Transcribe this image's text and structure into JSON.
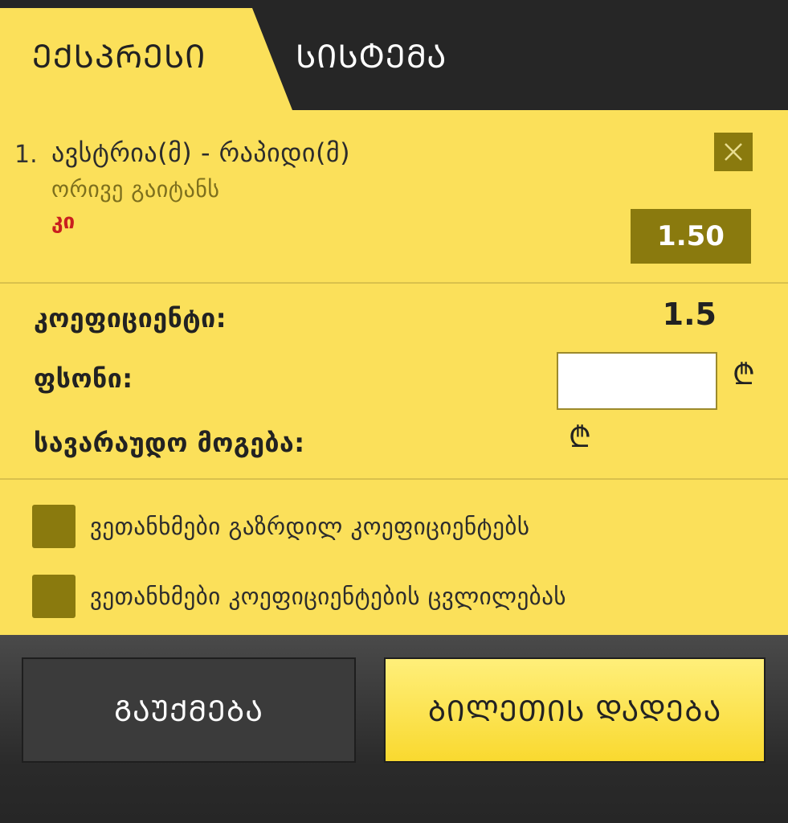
{
  "tabs": [
    {
      "label": "ᲔᲥᲡᲞᲠᲔᲡᲘ",
      "active": true
    },
    {
      "label": "ᲡᲘᲡᲢᲔᲛᲐ",
      "active": false
    }
  ],
  "bet": {
    "index": "1.",
    "match": "ავსტრია(მ) - რაპიდი(მ)",
    "market": "ორივე გაიტანს",
    "selection": "კი",
    "odd": "1.50"
  },
  "summary": {
    "coef_label": "კოეფიციენტი:",
    "coef_value": "1.5",
    "stake_label": "ფსონი:",
    "stake_value": "",
    "win_label": "სავარაუდო მოგება:",
    "currency": "₾"
  },
  "options": [
    {
      "label": "ვეთანხმები გაზრდილ კოეფიციენტებს",
      "checked": false
    },
    {
      "label": "ვეთანხმები კოეფიციენტების ცვლილებას",
      "checked": false
    }
  ],
  "buttons": {
    "cancel": "ᲒᲐᲣᲥᲛᲔᲑᲐ",
    "place": "ᲑᲘᲚᲔᲗᲘᲡ ᲓᲐᲓᲔᲑᲐ"
  },
  "colors": {
    "panel": "#fbe05a",
    "dark": "#262626",
    "accent_dark": "#8a7a0e",
    "selection_red": "#c91f1f"
  },
  "icons": {
    "close": "close-icon",
    "currency": "lari-icon"
  }
}
